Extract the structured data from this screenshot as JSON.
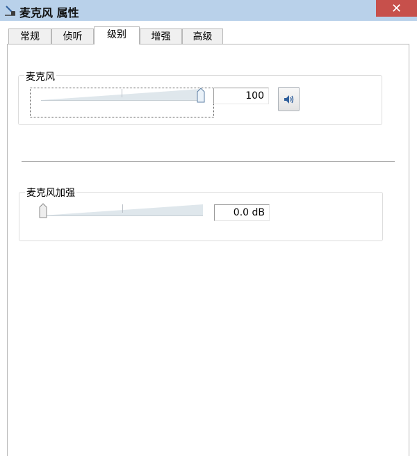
{
  "window": {
    "title": "麦克风 属性",
    "close_glyph": "✕"
  },
  "tabs": [
    {
      "label": "常规",
      "active": false
    },
    {
      "label": "侦听",
      "active": false
    },
    {
      "label": "级别",
      "active": true
    },
    {
      "label": "增强",
      "active": false
    },
    {
      "label": "高级",
      "active": false
    }
  ],
  "microphone": {
    "label": "麦克风",
    "value_text": "100",
    "level_fraction": 1.0,
    "mute_icon": "speaker-icon"
  },
  "boost": {
    "label": "麦克风加强",
    "value_text": "0.0 dB",
    "level_fraction": 0.0
  },
  "colors": {
    "titlebar": "#b9d1ea",
    "close_button": "#c7504b",
    "slider_fill": "#d8e3ea",
    "speaker_blue": "#2f5f9c"
  }
}
